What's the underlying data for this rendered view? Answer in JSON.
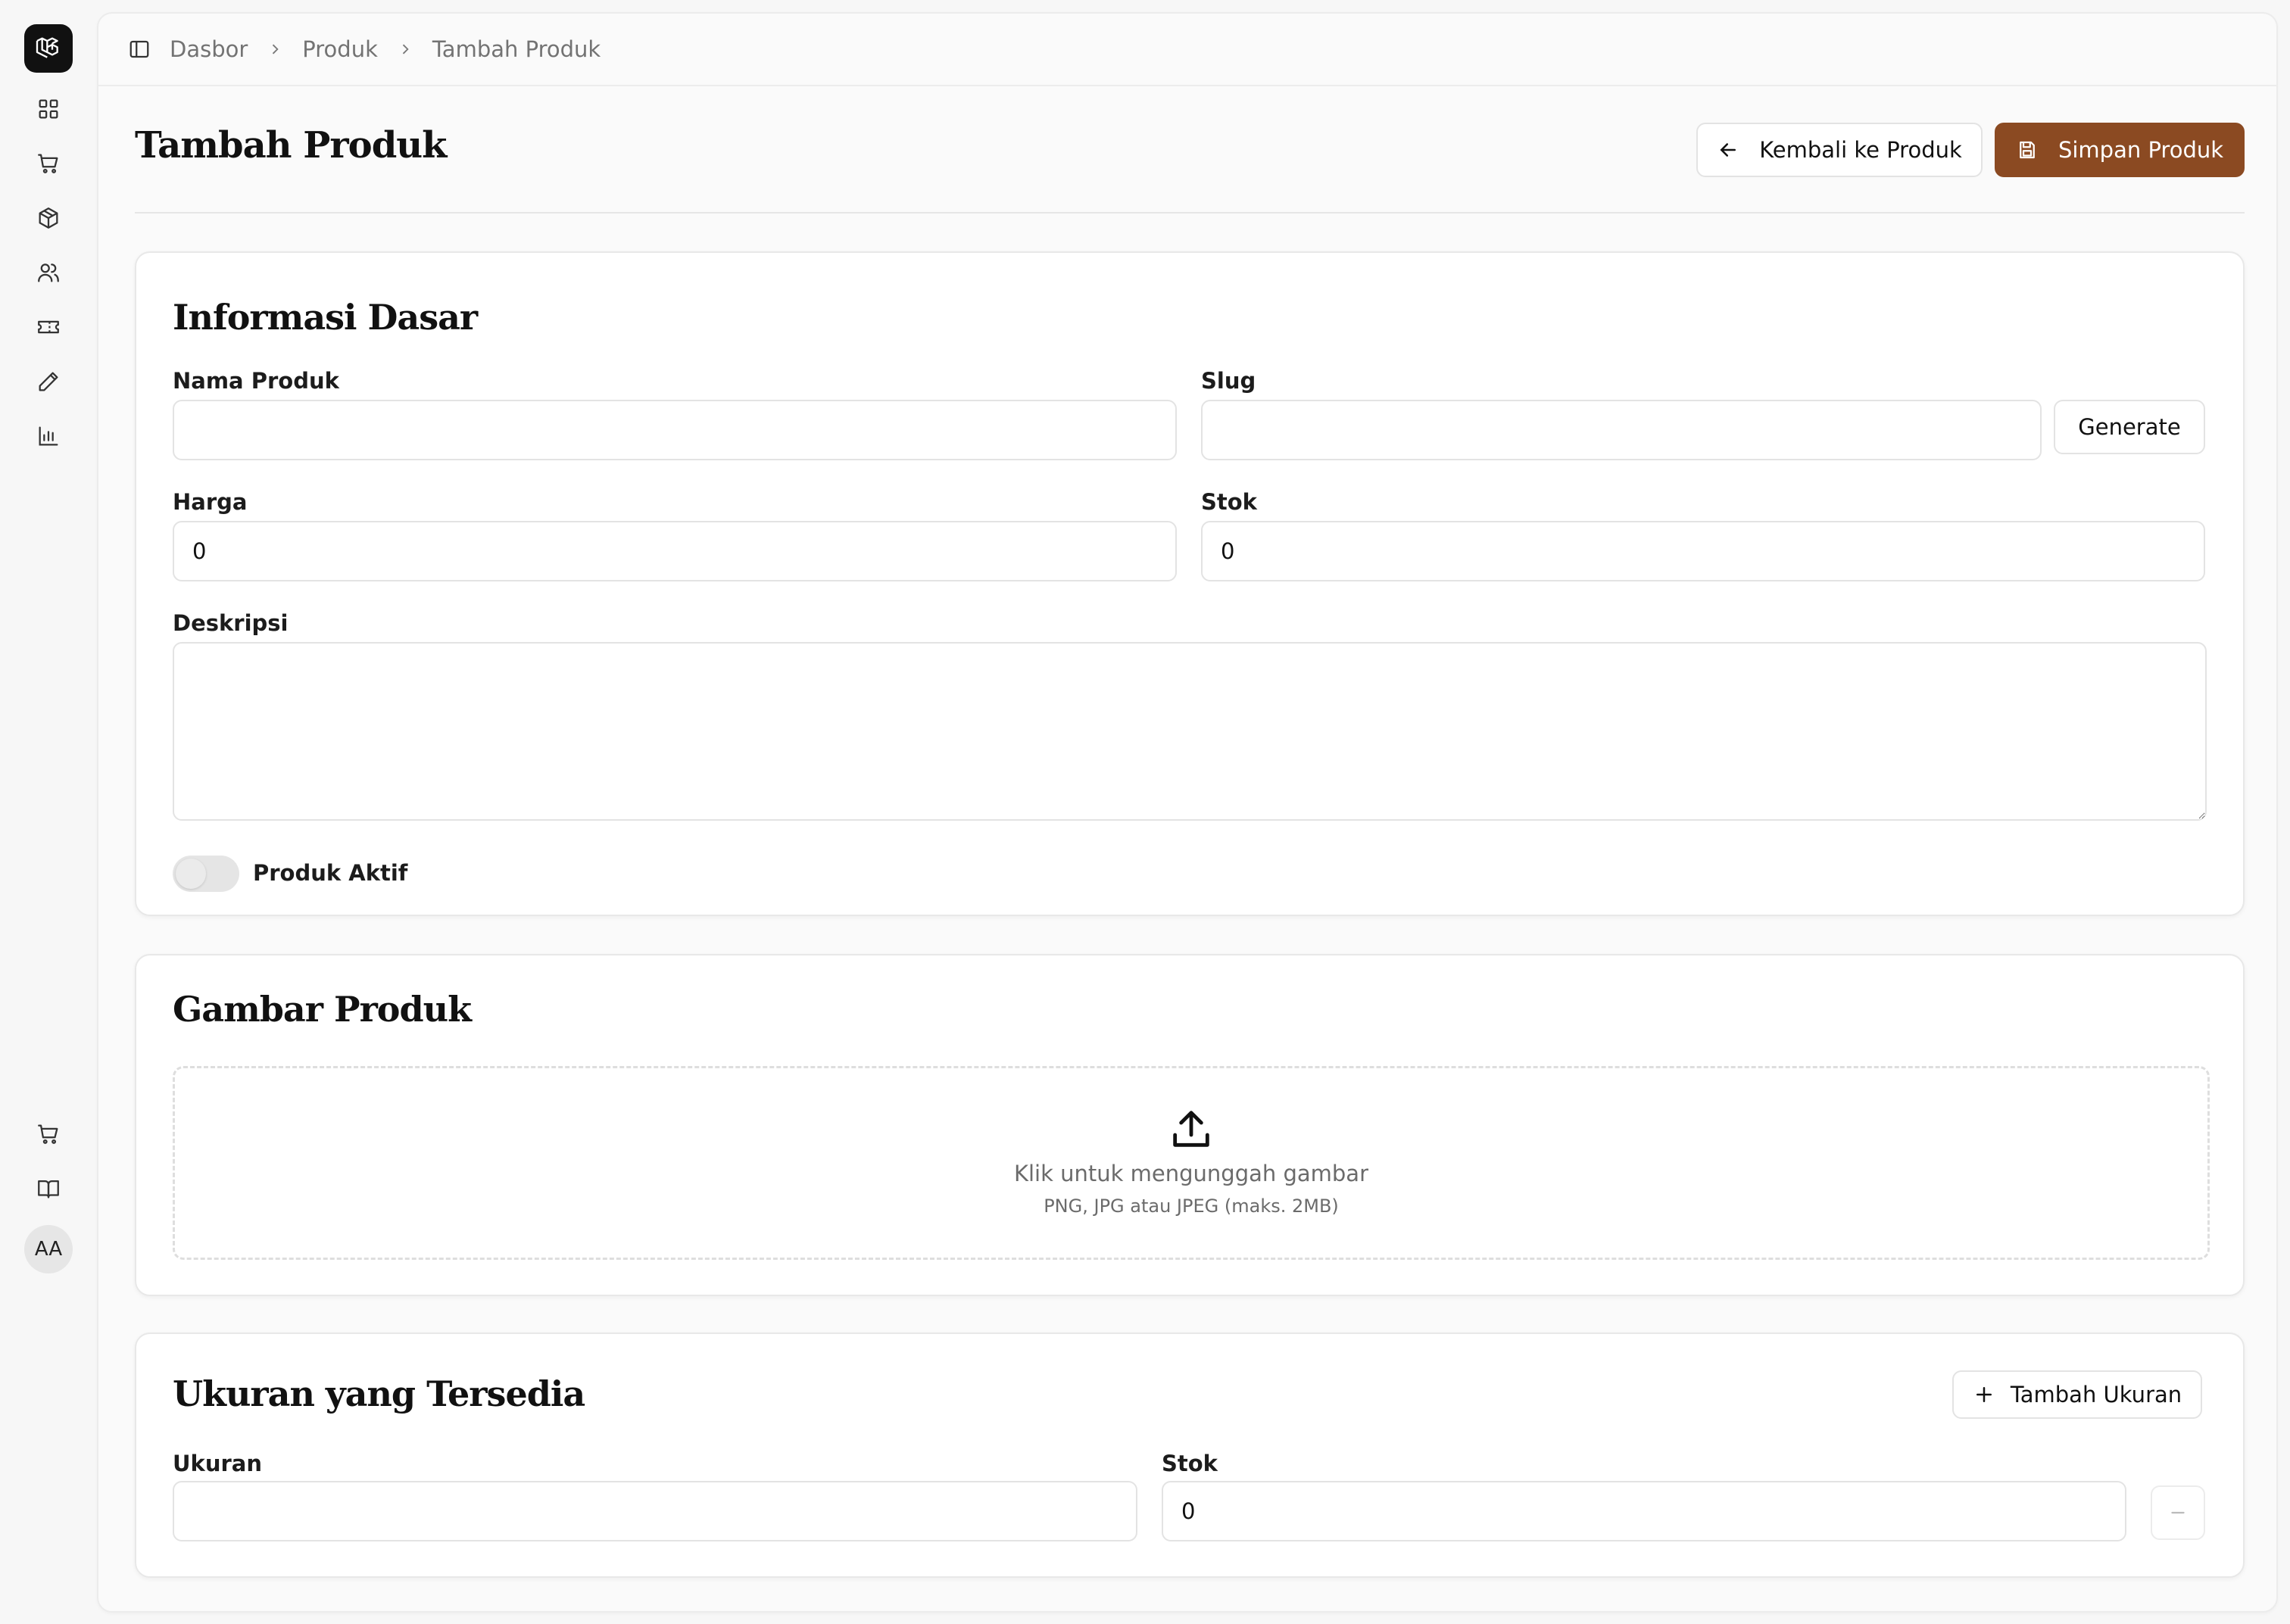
{
  "sidebar": {
    "logo": "laravel-logo-icon",
    "avatar_initials": "AA"
  },
  "breadcrumb": [
    "Dasbor",
    "Produk",
    "Tambah Produk"
  ],
  "page": {
    "title": "Tambah Produk",
    "back_label": "Kembali ke Produk",
    "save_label": "Simpan Produk"
  },
  "basic_info": {
    "title": "Informasi Dasar",
    "name_label": "Nama Produk",
    "name_value": "",
    "slug_label": "Slug",
    "slug_value": "",
    "generate_label": "Generate",
    "price_label": "Harga",
    "price_value": "0",
    "stock_label": "Stok",
    "stock_value": "0",
    "description_label": "Deskripsi",
    "description_value": "",
    "active_label": "Produk Aktif",
    "active": false
  },
  "images": {
    "title": "Gambar Produk",
    "upload_text": "Klik untuk mengunggah gambar",
    "upload_hint": "PNG, JPG atau JPEG (maks. 2MB)"
  },
  "sizes": {
    "title": "Ukuran yang Tersedia",
    "add_label": "Tambah Ukuran",
    "size_label": "Ukuran",
    "size_value": "",
    "stock_label": "Stok",
    "stock_value": "0"
  },
  "colors": {
    "accent": "#8b4a22"
  }
}
